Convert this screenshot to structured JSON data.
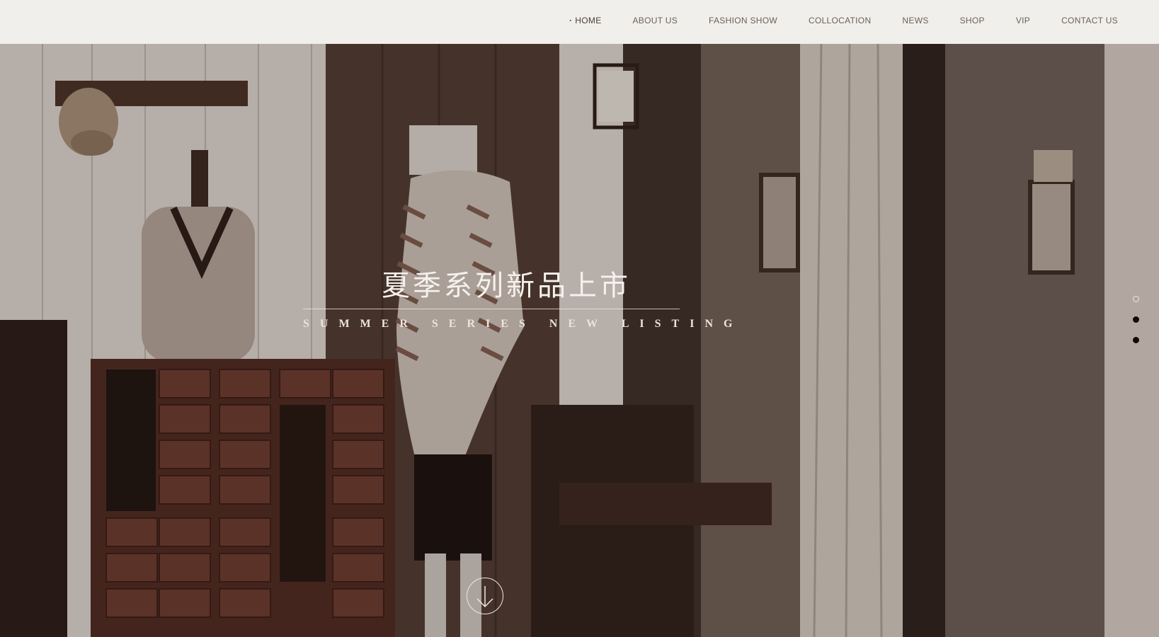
{
  "nav": {
    "items": [
      {
        "label": "HOME",
        "active": true
      },
      {
        "label": "ABOUT US",
        "active": false
      },
      {
        "label": "FASHION SHOW",
        "active": false
      },
      {
        "label": "COLLOCATION",
        "active": false
      },
      {
        "label": "NEWS",
        "active": false
      },
      {
        "label": "SHOP",
        "active": false
      },
      {
        "label": "VIP",
        "active": false
      },
      {
        "label": "CONTACT US",
        "active": false
      }
    ]
  },
  "hero": {
    "headline_cn": "夏季系列新品上市",
    "headline_en": "SUMMER SERIES NEW LISTING",
    "scroll_icon": "arrow-down-icon",
    "slides": [
      {
        "state": "active"
      },
      {
        "state": "inactive"
      },
      {
        "state": "inactive"
      }
    ]
  },
  "colors": {
    "nav_background": "#f1efeb",
    "nav_text": "#6a5f57",
    "hero_overlay": "#3e322c",
    "headline_text": "#f6f1ec"
  }
}
